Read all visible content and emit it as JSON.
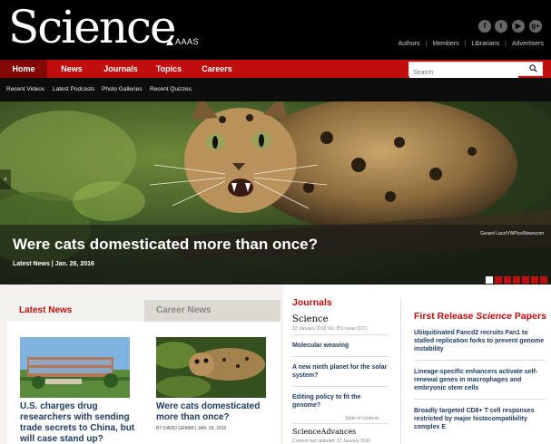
{
  "header": {
    "logo": "Science",
    "publisher": "AAAS",
    "social": [
      "f",
      "t",
      "▶",
      "g+"
    ],
    "social_icons": [
      "facebook-icon",
      "twitter-icon",
      "youtube-icon",
      "google-plus-icon"
    ],
    "links": [
      "Authors",
      "Members",
      "Librarians",
      "Advertisers"
    ]
  },
  "nav": {
    "items": [
      "Home",
      "News",
      "Journals",
      "Topics",
      "Careers"
    ],
    "search_placeholder": "Search"
  },
  "subnav": {
    "items": [
      "Recent Videos",
      "Latest Podcasts",
      "Photo Galleries",
      "Recent Quizzes"
    ]
  },
  "hero": {
    "title": "Were cats domesticated more than once?",
    "meta": "Latest News | Jan. 26, 2016",
    "credit": "Gerard Lacz/VWPics/Newscom",
    "slide_count": 7,
    "active_slide": 1
  },
  "tabs": {
    "news": "Latest News",
    "career": "Career News"
  },
  "cards": [
    {
      "title_lines": [
        "U.S. charges drug",
        "researchers with sending",
        "trade secrets to China, but",
        "will case stand up?"
      ],
      "byline": ""
    },
    {
      "title_lines": [
        "Were cats domesticated",
        "more than once?"
      ],
      "byline": "BY DAVID GRIMM  |  JAN. 26, 2016"
    }
  ],
  "journals": {
    "heading": "Journals",
    "logo": "Science",
    "meta": "22 January 2016 Vol. 351 Issue 6271",
    "items": [
      [
        "Molecular weaving"
      ],
      [
        "A new ninth planet for the solar",
        "system?"
      ],
      [
        "Editing policy to fit the",
        "genome?"
      ]
    ],
    "toc": "Table of contents",
    "logo2": "ScienceAdvances",
    "meta2": "Content last updated: 22 January 2016"
  },
  "first_release": {
    "heading_pre": "First Release ",
    "heading_em": "Science",
    "heading_post": " Papers",
    "items": [
      [
        "Ubiquitinated Fancd2 recruits Fan1 to",
        "stalled replication forks to prevent genome",
        "instability"
      ],
      [
        "Lineage-specific enhancers activate self-",
        "renewal genes in macrophages and",
        "embryonic stem cells"
      ],
      [
        "Broadly targeted CD8+ T cell responses",
        "restricted by major histocompatibility",
        "complex E"
      ]
    ]
  },
  "colors": {
    "brand_red": "#c00d0d",
    "link_blue": "#1f3b63",
    "dark_red": "#820808"
  }
}
